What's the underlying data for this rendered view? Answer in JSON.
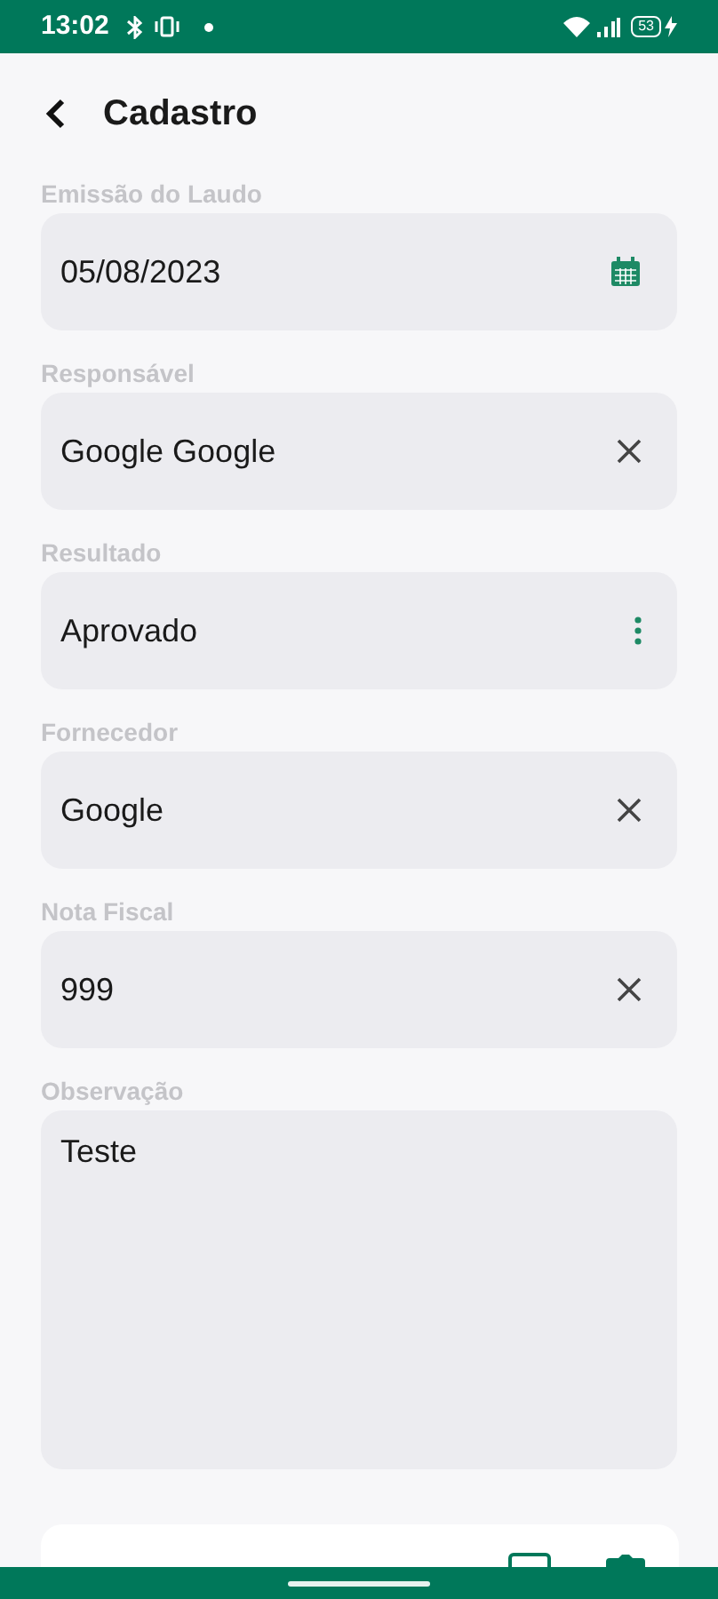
{
  "status_bar": {
    "time": "13:02",
    "battery": "53"
  },
  "header": {
    "title": "Cadastro"
  },
  "fields": [
    {
      "label": "Emissão do Laudo",
      "value": "05/08/2023",
      "kind": "date"
    },
    {
      "label": "Responsável",
      "value": "Google Google",
      "kind": "clear"
    },
    {
      "label": "Resultado",
      "value": "Aprovado",
      "kind": "menu"
    },
    {
      "label": "Fornecedor",
      "value": "Google",
      "kind": "clear"
    },
    {
      "label": "Nota Fiscal",
      "value": "999",
      "kind": "clear"
    },
    {
      "label": "Observação",
      "value": "Teste",
      "kind": "textarea"
    }
  ]
}
